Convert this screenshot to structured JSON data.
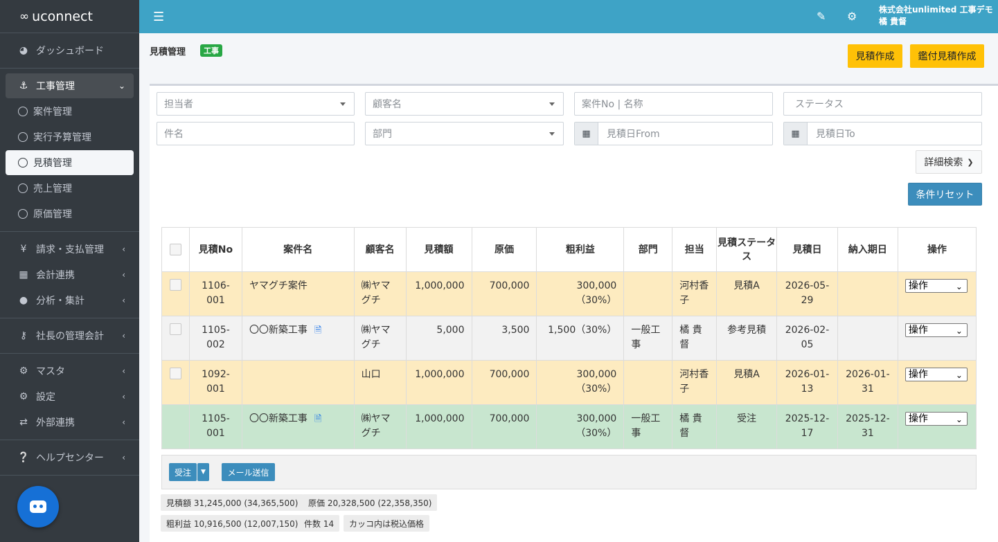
{
  "brand": {
    "name": "uconnect"
  },
  "sidebar": {
    "items": [
      {
        "label": "ダッシュボード"
      },
      {
        "label": "工事管理"
      },
      {
        "label": "案件管理"
      },
      {
        "label": "実行予算管理"
      },
      {
        "label": "見積管理"
      },
      {
        "label": "売上管理"
      },
      {
        "label": "原価管理"
      },
      {
        "label": "請求・支払管理"
      },
      {
        "label": "会計連携"
      },
      {
        "label": "分析・集計"
      },
      {
        "label": "社長の管理会計"
      },
      {
        "label": "マスタ"
      },
      {
        "label": "設定"
      },
      {
        "label": "外部連携"
      },
      {
        "label": "ヘルプセンター"
      }
    ]
  },
  "header": {
    "company": "株式会社unlimited 工事デモ",
    "user": "橘 貴督"
  },
  "page": {
    "title": "見積管理",
    "badge": "工事",
    "create_label": "見積作成",
    "seal_create_label": "鑑付見積作成"
  },
  "filters": {
    "assignee": "担当者",
    "customer": "顧客名",
    "case_no": "案件No | 名称",
    "status": "ステータス",
    "subject": "件名",
    "department": "部門",
    "date_from": "見積日From",
    "date_to": "見積日To",
    "detail_search": "詳細検索",
    "reset": "条件リセット"
  },
  "table": {
    "headers": [
      "見積No",
      "案件名",
      "顧客名",
      "見積額",
      "原価",
      "粗利益",
      "部門",
      "担当",
      "見積ステータス",
      "見積日",
      "納入期日",
      "操作"
    ],
    "rows": [
      {
        "no": "1106-001",
        "case": "ヤマグチ案件",
        "customer": "㈱ヤマグチ",
        "amount": "1,000,000",
        "cost": "700,000",
        "profit": "300,000（30%）",
        "dept": "",
        "person": "河村香子",
        "status": "見積A",
        "date": "2026-05-29",
        "due": "",
        "op": "操作"
      },
      {
        "no": "1105-002",
        "case": "〇〇新築工事",
        "customer": "㈱ヤマグチ",
        "amount": "5,000",
        "cost": "3,500",
        "profit": "1,500（30%）",
        "dept": "一般工事",
        "person": "橘 貴督",
        "status": "参考見積",
        "date": "2026-02-05",
        "due": "",
        "op": "操作"
      },
      {
        "no": "1092-001",
        "case": "",
        "customer": "山口",
        "amount": "1,000,000",
        "cost": "700,000",
        "profit": "300,000（30%）",
        "dept": "",
        "person": "河村香子",
        "status": "見積A",
        "date": "2026-01-13",
        "due": "2026-01-31",
        "op": "操作"
      },
      {
        "no": "1105-001",
        "case": "〇〇新築工事",
        "customer": "㈱ヤマグチ",
        "amount": "1,000,000",
        "cost": "700,000",
        "profit": "300,000（30%）",
        "dept": "一般工事",
        "person": "橘 貴督",
        "status": "受注",
        "date": "2025-12-17",
        "due": "2025-12-31",
        "op": "操作"
      }
    ]
  },
  "actions": {
    "order": "受注",
    "mail": "メール送信"
  },
  "summary": {
    "amount": "見積額 31,245,000 (34,365,500)",
    "cost": "原価 20,328,500 (22,358,350)",
    "profit": "粗利益 10,916,500 (12,007,150)",
    "count": "件数 14",
    "tax_note": "カッコ内は税込価格"
  }
}
